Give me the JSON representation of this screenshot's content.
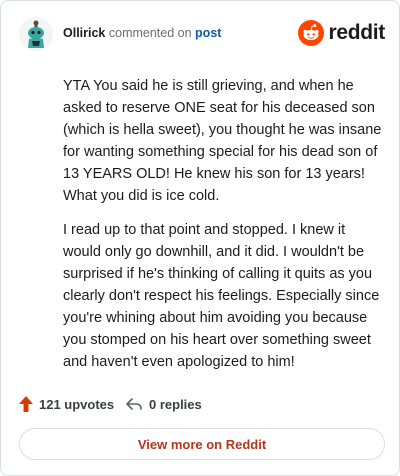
{
  "header": {
    "username": "Ollirick",
    "action_text": "commented on",
    "post_link": "post",
    "brand_name": "reddit",
    "brand_color": "#ff4500"
  },
  "comment": {
    "paragraphs": [
      "YTA You said he is still grieving, and when he asked to reserve ONE seat for his deceased son (which is hella sweet), you thought he was insane for wanting something special for his dead son of 13 YEARS OLD! He knew his son for 13 years! What you did is ice cold.",
      "I read up to that point and stopped. I knew it would only go downhill, and it did. I wouldn't be surprised if he's thinking of calling it quits as you clearly don't respect his feelings. Especially since you're whining about him avoiding you because you stomped on his heart over something sweet and haven't even apologized to him!"
    ]
  },
  "footer": {
    "upvotes": "121 upvotes",
    "replies": "0 replies",
    "upvote_icon": "upvote-arrow-icon",
    "reply_icon": "reply-arrow-icon"
  },
  "cta": {
    "label": "View more on Reddit"
  }
}
